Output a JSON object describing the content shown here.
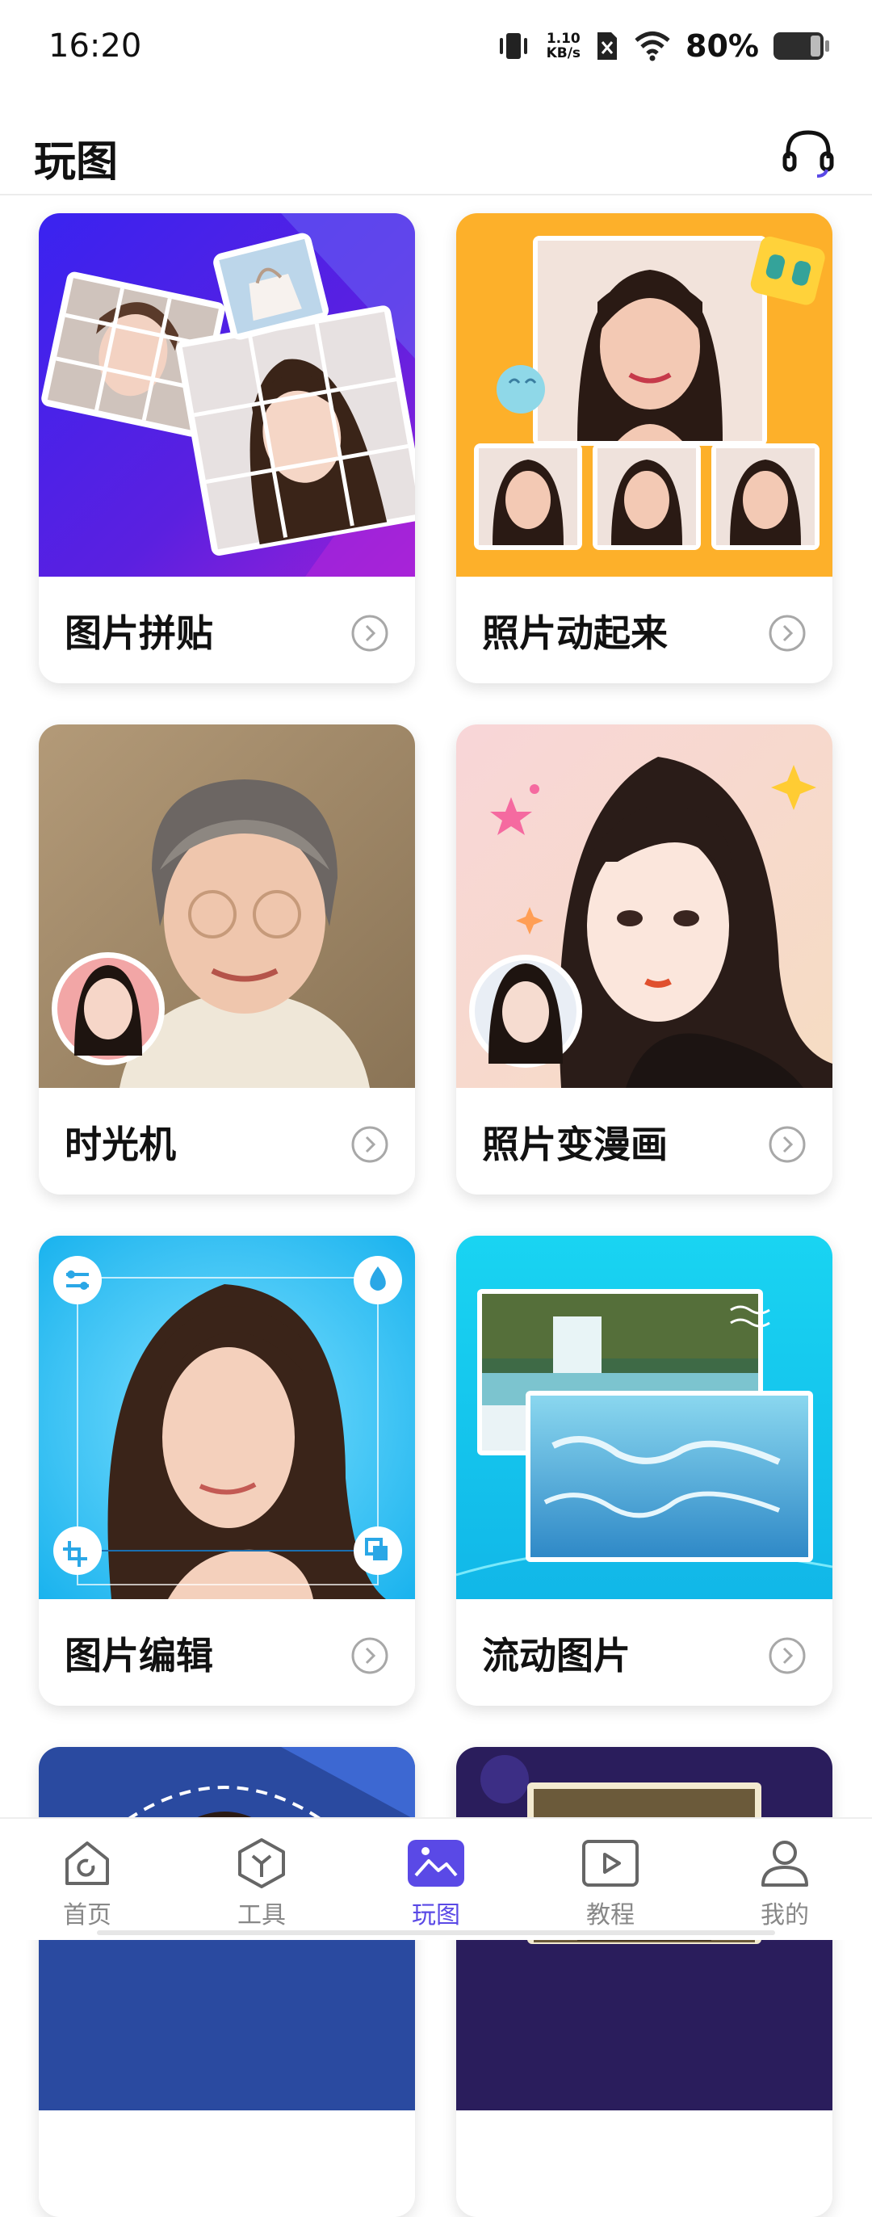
{
  "status": {
    "time": "16:20",
    "speed_top": "1.10",
    "speed_bottom": "KB/s",
    "battery": "80%"
  },
  "header": {
    "title": "玩图",
    "support_icon": "headset-icon"
  },
  "cards": [
    {
      "label": "图片拼贴"
    },
    {
      "label": "照片动起来"
    },
    {
      "label": "时光机"
    },
    {
      "label": "照片变漫画"
    },
    {
      "label": "图片编辑"
    },
    {
      "label": "流动图片"
    }
  ],
  "nav": [
    {
      "label": "首页",
      "icon": "home-icon"
    },
    {
      "label": "工具",
      "icon": "cube-icon"
    },
    {
      "label": "玩图",
      "icon": "image-icon",
      "active": true
    },
    {
      "label": "教程",
      "icon": "play-icon"
    },
    {
      "label": "我的",
      "icon": "person-icon"
    }
  ],
  "colors": {
    "accent": "#5a49e6",
    "arrow": "#a8a8a8"
  }
}
